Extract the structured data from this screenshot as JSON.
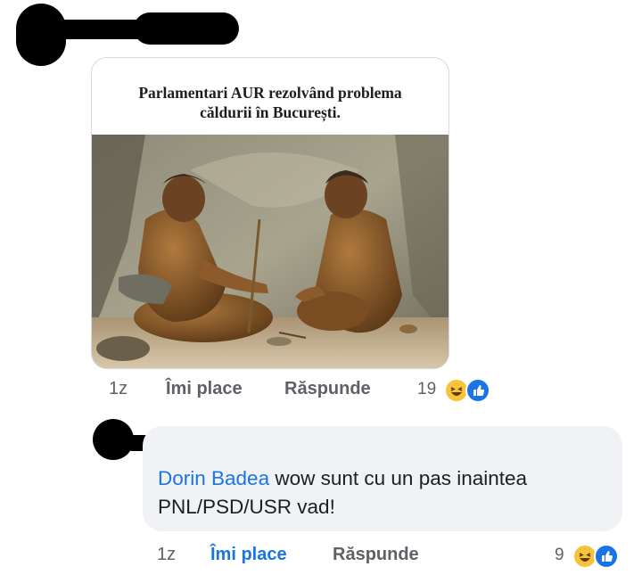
{
  "post": {
    "meme_caption_line1": "Parlamentari AUR rezolvând problema",
    "meme_caption_line2": "căldurii în București.",
    "time": "1z",
    "like_label": "Îmi place",
    "reply_label": "Răspunde",
    "reaction_count": "19",
    "reactions": [
      "haha-emoji-icon",
      "like-icon"
    ]
  },
  "reply": {
    "author": "Dorin Badea",
    "text": "wow sunt cu un pas inaintea PNL/PSD/USR vad!",
    "time": "1z",
    "like_label": "Îmi place",
    "reply_label": "Răspunde",
    "reaction_count": "9",
    "reactions": [
      "haha-emoji-icon",
      "like-icon"
    ]
  },
  "colors": {
    "link_blue": "#1b74e4",
    "bubble_bg": "#f0f2f5",
    "meta_gray": "#5f6166"
  }
}
